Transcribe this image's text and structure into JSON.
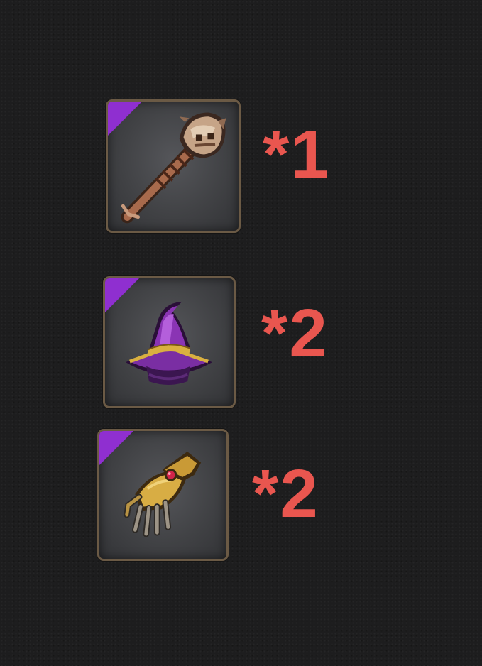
{
  "items": [
    {
      "icon": "bone-club-icon",
      "rarity_color": "#8f2fd0",
      "quantity_label": "*1"
    },
    {
      "icon": "wizard-hat-icon",
      "rarity_color": "#8f2fd0",
      "quantity_label": "*2"
    },
    {
      "icon": "gauntlet-icon",
      "rarity_color": "#8f2fd0",
      "quantity_label": "*2"
    }
  ],
  "colors": {
    "quantity_text": "#e9564f",
    "slot_border": "#6b5a45",
    "background": "#1d1d1e"
  }
}
